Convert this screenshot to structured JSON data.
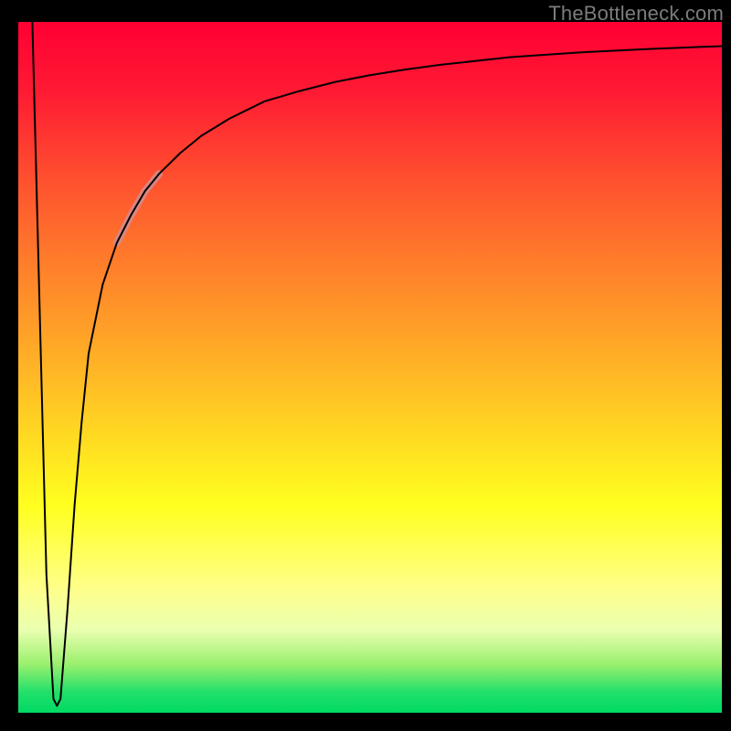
{
  "watermark": "TheBottleneck.com",
  "chart_data": {
    "type": "line",
    "title": "",
    "xlabel": "",
    "ylabel": "",
    "xlim": [
      0,
      100
    ],
    "ylim": [
      0,
      100
    ],
    "background_gradient": {
      "orientation": "vertical",
      "stops": [
        {
          "pos": 0.0,
          "color": "#ff0033"
        },
        {
          "pos": 0.22,
          "color": "#ff4d2f"
        },
        {
          "pos": 0.46,
          "color": "#ffa527"
        },
        {
          "pos": 0.7,
          "color": "#ffff1f"
        },
        {
          "pos": 0.88,
          "color": "#eaffb0"
        },
        {
          "pos": 0.97,
          "color": "#22e06a"
        },
        {
          "pos": 1.0,
          "color": "#00d964"
        }
      ]
    },
    "series": [
      {
        "name": "bottleneck-curve",
        "color": "#000000",
        "width": 2,
        "x": [
          2,
          3,
          4,
          5,
          5.5,
          6,
          7,
          8,
          9,
          10,
          12,
          14,
          16,
          18,
          20,
          23,
          26,
          30,
          35,
          40,
          45,
          50,
          55,
          60,
          70,
          80,
          90,
          100
        ],
        "y": [
          100,
          60,
          20,
          2,
          1,
          2,
          15,
          30,
          42,
          52,
          62,
          68,
          72,
          75.5,
          78,
          81,
          83.5,
          86,
          88.5,
          90,
          91.3,
          92.3,
          93.1,
          93.8,
          94.9,
          95.6,
          96.1,
          96.5
        ]
      },
      {
        "name": "highlight-segment",
        "color": "#d68a8a",
        "width": 8,
        "opacity": 0.9,
        "x": [
          14,
          16,
          18,
          20
        ],
        "y": [
          68,
          72,
          75.5,
          78
        ]
      }
    ],
    "annotations": []
  }
}
